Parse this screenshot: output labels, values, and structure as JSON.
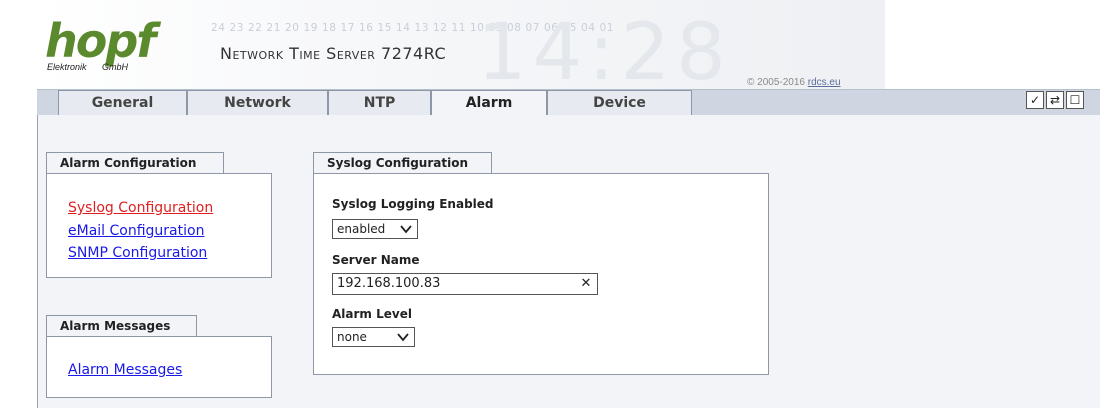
{
  "header": {
    "logo_word": "hopf",
    "logo_sub": "Elektronik",
    "logo_sub2": "GmbH",
    "bg_numbers": "24 23 22 21 20 19 18 17 16 15 14 13 12 11 10 09 08 07 06 05 04 01",
    "bg_clock": "14:28",
    "product_title": "Network Time Server 7274RC",
    "copyright_prefix": "© 2005-2016",
    "copyright_link": "rdcs.eu"
  },
  "tabs": [
    {
      "label": "General",
      "active": false
    },
    {
      "label": "Network",
      "active": false
    },
    {
      "label": "NTP",
      "active": false
    },
    {
      "label": "Alarm",
      "active": true
    },
    {
      "label": "Device",
      "active": false
    }
  ],
  "toolbar": {
    "buttons": [
      {
        "name": "apply",
        "icon": "check-icon",
        "glyph": "✓"
      },
      {
        "name": "reload",
        "icon": "refresh-icon",
        "glyph": "⇄"
      },
      {
        "name": "save",
        "icon": "page-icon",
        "glyph": "☐"
      }
    ]
  },
  "alarm_configuration": {
    "title": "Alarm Configuration",
    "links": [
      "Syslog Configuration",
      "eMail Configuration",
      "SNMP Configuration"
    ],
    "current_link": "Syslog Configuration"
  },
  "alarm_messages": {
    "title": "Alarm Messages",
    "link": "Alarm Messages"
  },
  "syslog": {
    "title": "Syslog Configuration",
    "logging_label": "Syslog Logging Enabled",
    "logging_value": "enabled",
    "server_label": "Server Name",
    "server_value": "192.168.100.83",
    "level_label": "Alarm Level",
    "level_value": "none"
  },
  "colors": {
    "brand_green": "#5b8a2e",
    "link_blue": "#1a1ae6",
    "link_current_red": "#e02020",
    "panel_bg": "#f2f4f8",
    "tabbar_bg": "#cfd6e1"
  }
}
